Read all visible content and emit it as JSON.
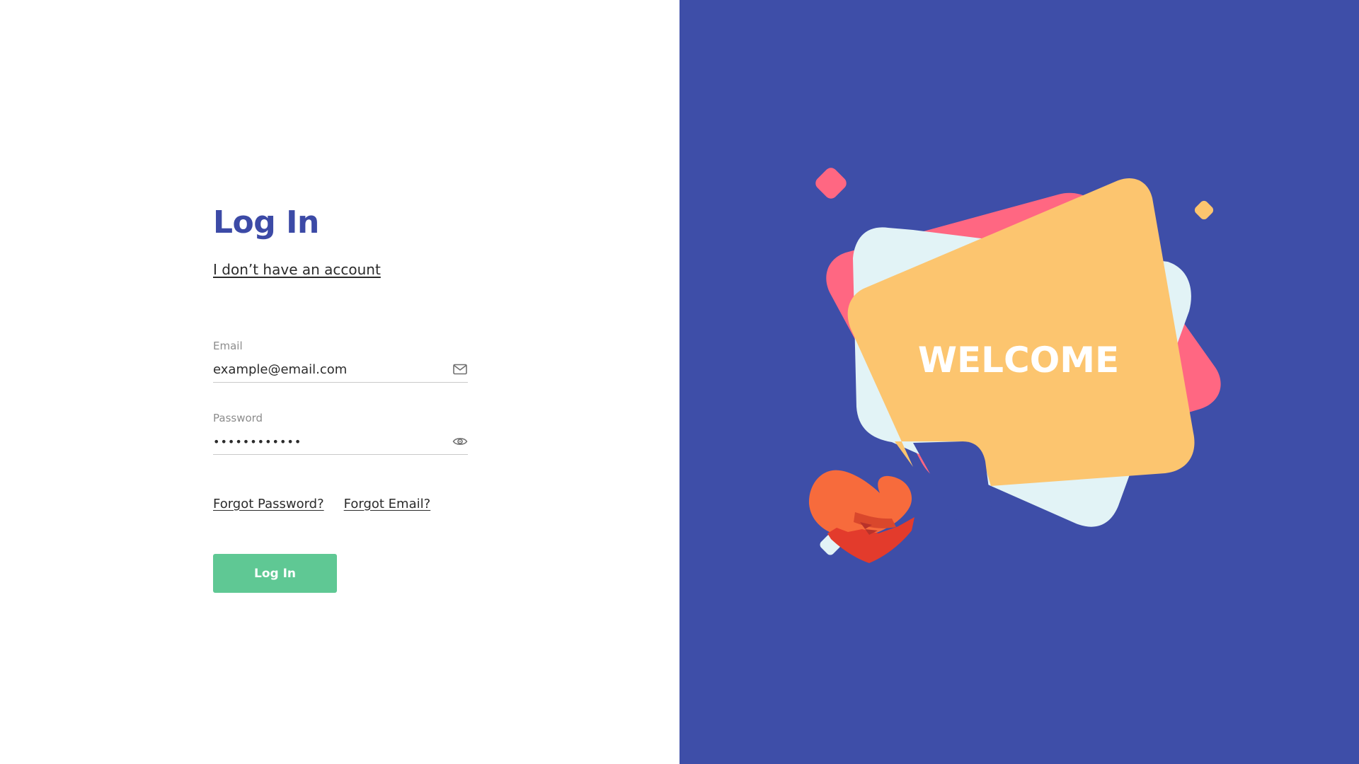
{
  "login": {
    "title": "Log In",
    "signup_link": "I don’t have an account",
    "email": {
      "label": "Email",
      "value": "example@email.com",
      "icon": "mail-icon"
    },
    "password": {
      "label": "Password",
      "value": "••••••••••••",
      "icon": "eye-icon"
    },
    "forgot_password": "Forgot Password?",
    "forgot_email": "Forgot Email?",
    "submit_label": "Log In"
  },
  "hero": {
    "welcome_text": "WELCOME",
    "logo_icon": "heart-hug-icon"
  },
  "colors": {
    "title": "#3c4aa6",
    "button": "#5fc894",
    "panel_bg": "#3e4ea8",
    "card_yellow": "#fcc56f",
    "card_pink": "#ff6782",
    "card_light": "#e2f3f6",
    "heart_orange": "#f76b3c"
  }
}
